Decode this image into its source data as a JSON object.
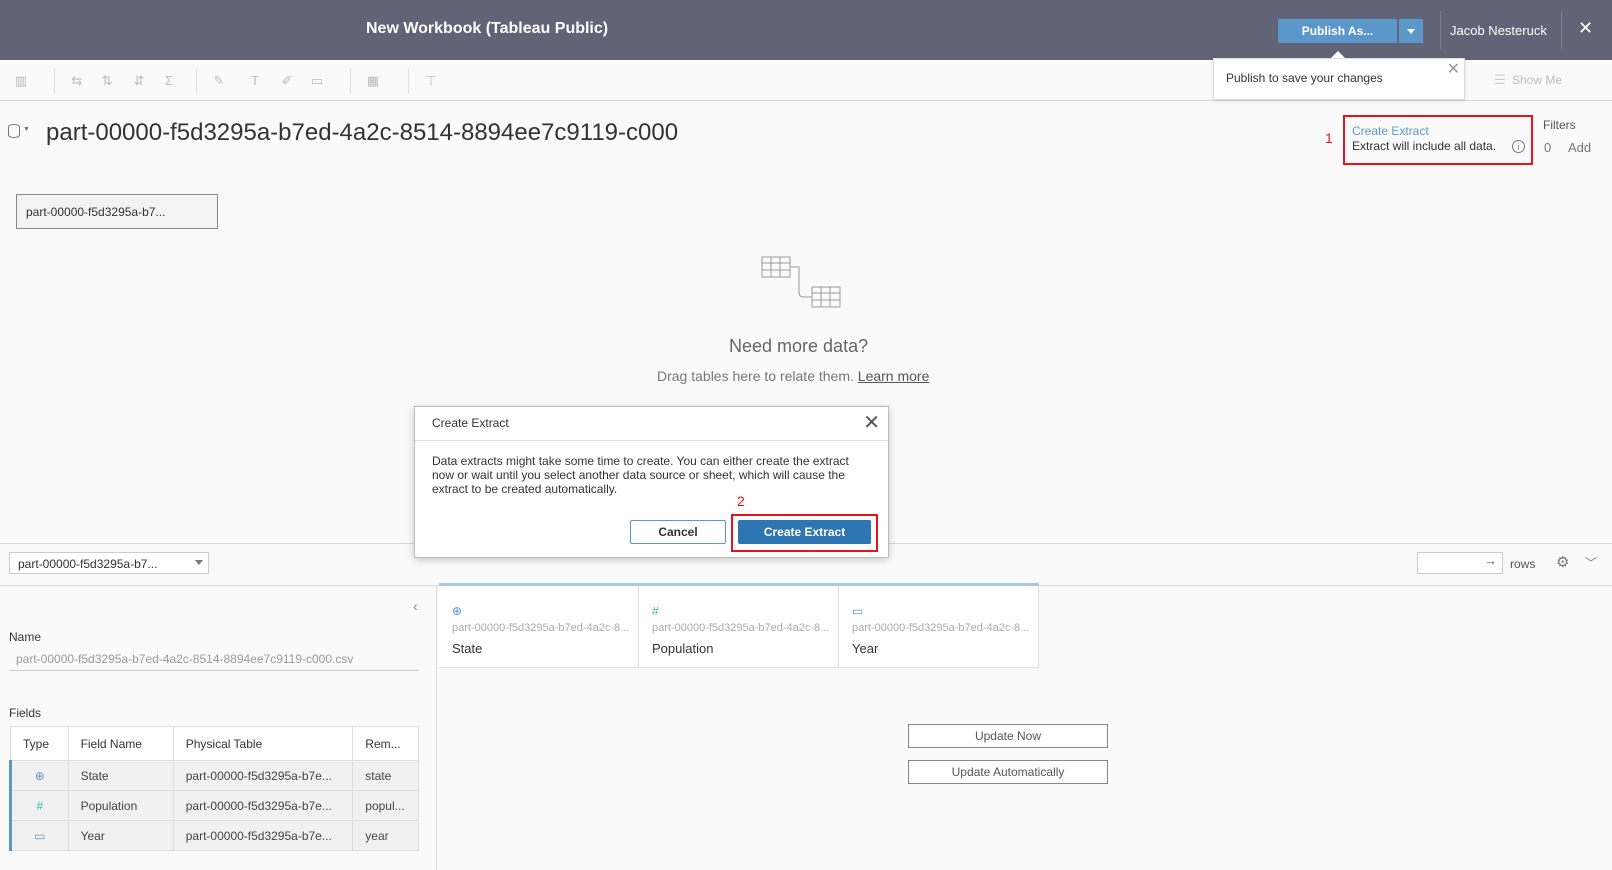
{
  "titlebar": {
    "title": "New Workbook (Tableau Public)",
    "publish_label": "Publish As...",
    "user": "Jacob Nesteruck",
    "close_glyph": "✕"
  },
  "toolbar": {
    "show_me": "Show Me"
  },
  "publish_popup": {
    "text": "Publish to save your changes",
    "close_glyph": "✕"
  },
  "datasource": {
    "title": "part-00000-f5d3295a-b7ed-4a2c-8514-8894ee7c9119-c000",
    "table_chip": "part-00000-f5d3295a-b7...",
    "connection": {
      "annotation": "1",
      "create_extract_label": "Create Extract",
      "extract_info": "Extract will include all data.",
      "info_glyph": "i"
    },
    "filters": {
      "label": "Filters",
      "count": "0",
      "add_label": "Add"
    }
  },
  "canvas": {
    "heading": "Need more data?",
    "sub": "Drag tables here to relate them.",
    "learn_more": "Learn more"
  },
  "strip": {
    "table_select": "part-00000-f5d3295a-b7...",
    "rows_label": "rows",
    "rows_arrow": "→",
    "gear_glyph": "⚙",
    "chevron_glyph": "⌄"
  },
  "metadata": {
    "collapse_glyph": "‹",
    "name_label": "Name",
    "name_value": "part-00000-f5d3295a-b7ed-4a2c-8514-8894ee7c9119-c000.csv",
    "fields_label": "Fields",
    "columns": [
      "Type",
      "Field Name",
      "Physical Table",
      "Rem..."
    ],
    "rows": [
      {
        "type_icon": "globe-icon",
        "type_glyph": "⊕",
        "field": "State",
        "table": "part-00000-f5d3295a-b7e...",
        "remote": "state"
      },
      {
        "type_icon": "number-icon",
        "type_glyph": "#",
        "field": "Population",
        "table": "part-00000-f5d3295a-b7e...",
        "remote": "popul..."
      },
      {
        "type_icon": "calendar-icon",
        "type_glyph": "▭",
        "field": "Year",
        "table": "part-00000-f5d3295a-b7e...",
        "remote": "year"
      }
    ]
  },
  "grid": {
    "columns": [
      {
        "icon": "globe-icon",
        "glyph": "⊕",
        "source": "part-00000-f5d3295a-b7ed-4a2c-8...",
        "name": "State"
      },
      {
        "icon": "number-icon",
        "glyph": "#",
        "source": "part-00000-f5d3295a-b7ed-4a2c-8...",
        "name": "Population"
      },
      {
        "icon": "calendar-icon",
        "glyph": "▭",
        "source": "part-00000-f5d3295a-b7ed-4a2c-8...",
        "name": "Year"
      }
    ],
    "update_now": "Update Now",
    "update_auto": "Update Automatically"
  },
  "dialog": {
    "title": "Create Extract",
    "close_glyph": "✕",
    "body": "Data extracts might take some time to create. You can either create the extract now or wait until you select another data source or sheet, which will cause the extract to be created automatically.",
    "annotation": "2",
    "cancel": "Cancel",
    "confirm": "Create Extract"
  },
  "colors": {
    "titlebar": "#616476",
    "accent": "#5b98c9",
    "primary_button": "#2e76b2",
    "annotation_red": "#e8141b",
    "number_green": "#3bb79b"
  }
}
